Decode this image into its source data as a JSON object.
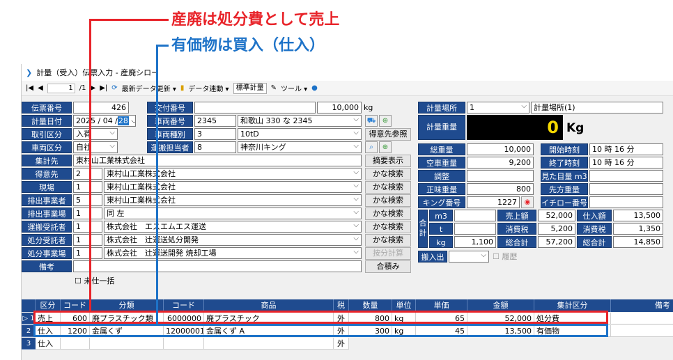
{
  "annotations": {
    "red_text": "産廃は処分費として売上",
    "blue_text": "有価物は買入（仕入）"
  },
  "window": {
    "title": "計量（受入）伝票入力 - 産廃シロー"
  },
  "toolbar": {
    "first": "|◀",
    "prev": "◀",
    "record": "1",
    "total": "/1",
    "next": "▶",
    "last": "▶|",
    "refresh": "最新データ更新 ▾",
    "data_link": "データ連動 ▾",
    "mode": "標準計量",
    "tools": "ツール ▾"
  },
  "left": {
    "slip_no_label": "伝票番号",
    "slip_no": "426",
    "issue_no_label": "交付番号",
    "issue_no": "",
    "measure_date_label": "計量日付",
    "measure_date_y": "2025 / 04 /",
    "measure_date_d": "28",
    "vehicle_no_label": "車両番号",
    "vehicle_no_code": "2345",
    "vehicle_no_name": "和歌山 330 な 2345",
    "capacity": "10,000",
    "capacity_unit": "kg",
    "trade_label": "取引区分",
    "trade": "入荷",
    "vehicle_type_label": "車両種別",
    "vehicle_type_code": "3",
    "vehicle_type_name": "10tD",
    "customer_ref": "得意先参照",
    "vehicle_div_label": "車両区分",
    "vehicle_div": "自社",
    "driver_label": "運搬担当者",
    "driver_code": "8",
    "driver_name": "神奈川キング",
    "bill_label": "集計先",
    "bill": "東村山工業株式会社",
    "summary_btn": "摘要表示",
    "customer_label": "得意先",
    "customer_code": "2",
    "customer_name": "東村山工業株式会社",
    "site_label": "現場",
    "site_code": "1",
    "site_name": "東村山工業株式会社",
    "emitter_label": "排出事業者",
    "emitter_code": "5",
    "emitter_name": "東村山工業株式会社",
    "emit_site_label": "排出事業場",
    "emit_site_code": "1",
    "emit_site_name": "同 左",
    "transport_label": "運搬受託者",
    "transport_code": "1",
    "transport_name": "株式会社　エスエムエス運送",
    "disposal_label": "処分受託者",
    "disposal_code": "1",
    "disposal_name": "株式会社　辻運送処分開発",
    "disposal_site_label": "処分事業場",
    "disposal_site_code": "1",
    "disposal_site_name": "株式会社　辻運送開発 焼却工場",
    "note_label": "備考",
    "note": "",
    "search": "かな検索",
    "price_calc": "按分計算",
    "combine": "合積み",
    "batch_label": "未仕一括"
  },
  "right": {
    "place_label": "計量場所",
    "place_code": "1",
    "place_name": "計量場所(1)",
    "weight_label": "計量重量",
    "weight_value": "0",
    "weight_unit": "Kg",
    "gross_label": "総重量",
    "gross": "10,000",
    "start_label": "開始時刻",
    "start": "10 時  16 分",
    "empty_label": "空車重量",
    "empty": "9,200",
    "end_label": "終了時刻",
    "end": "10 時  16 分",
    "adjust_label": "調整",
    "adjust": "",
    "est_label": "見た目量 m3",
    "est": "",
    "net_label": "正味重量",
    "net": "800",
    "dest_label": "先方重量",
    "dest": "",
    "king_label": "キング番号",
    "king": "1227",
    "ichiro_label": "イチロー番号",
    "ichiro": "",
    "sum_label": "合計",
    "m3_label": "m3",
    "m3": "",
    "t_label": "t",
    "t": "",
    "kg_label": "kg",
    "kg": "1,100",
    "sales_label": "売上額",
    "sales": "52,000",
    "purchase_label": "仕入額",
    "purchase": "13,500",
    "tax_label": "消費税",
    "tax_sales": "5,200",
    "tax_purchase": "1,350",
    "total_label": "総合計",
    "total_sales": "57,200",
    "total_purchase": "14,850",
    "inout_label": "搬入出",
    "history_label": "履歴"
  },
  "grid": {
    "headers": [
      "区分",
      "コード",
      "分類",
      "コード",
      "商品",
      "税",
      "数量",
      "単位",
      "単価",
      "金額",
      "集計区分",
      "備考"
    ],
    "rows": [
      {
        "n": "1",
        "kbn": "売上",
        "code1": "600",
        "cat": "廃プラスチック類",
        "code2": "6000000",
        "item": "廃プラスチック",
        "tax": "外",
        "qty": "800",
        "unit": "kg",
        "price": "65",
        "amount": "52,000",
        "agg": "処分費"
      },
      {
        "n": "2",
        "kbn": "仕入",
        "code1": "1200",
        "cat": "金属くず",
        "code2": "12000001",
        "item": "金属くず A",
        "tax": "外",
        "qty": "300",
        "unit": "kg",
        "price": "45",
        "amount": "13,500",
        "agg": "有価物"
      },
      {
        "n": "3",
        "kbn": "仕入",
        "code1": "",
        "cat": "",
        "code2": "",
        "item": "",
        "tax": "外",
        "qty": "",
        "unit": "",
        "price": "",
        "amount": "",
        "agg": ""
      }
    ]
  },
  "colors": {
    "header_blue": "#1f4b8f",
    "red": "#e8242a",
    "blue": "#1e73c8"
  }
}
